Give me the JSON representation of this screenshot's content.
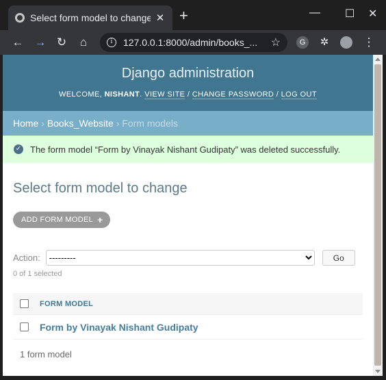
{
  "browser": {
    "tab_title": "Select form model to change",
    "url": "127.0.0.1:8000/admin/books_..."
  },
  "header": {
    "brand": "Django administration",
    "welcome": "WELCOME,",
    "user": "NISHANT",
    "view_site": "VIEW SITE",
    "change_password": "CHANGE PASSWORD",
    "log_out": "LOG OUT"
  },
  "breadcrumbs": {
    "home": "Home",
    "app": "Books_Website",
    "current": "Form models"
  },
  "message": "The form model “Form by Vinayak Nishant Gudipaty” was deleted successfully.",
  "content": {
    "title": "Select form model to change",
    "add_button": "ADD FORM MODEL",
    "action_label": "Action:",
    "action_selected": "---------",
    "go_button": "Go",
    "counter": "0 of 1 selected",
    "column_header": "FORM MODEL",
    "rows": [
      {
        "label": "Form by Vinayak Nishant Gudipaty"
      }
    ],
    "paginator": "1 form model"
  },
  "colors": {
    "header": "#417690",
    "breadcrumbs": "#79aec8",
    "success": "#ddffdd"
  }
}
